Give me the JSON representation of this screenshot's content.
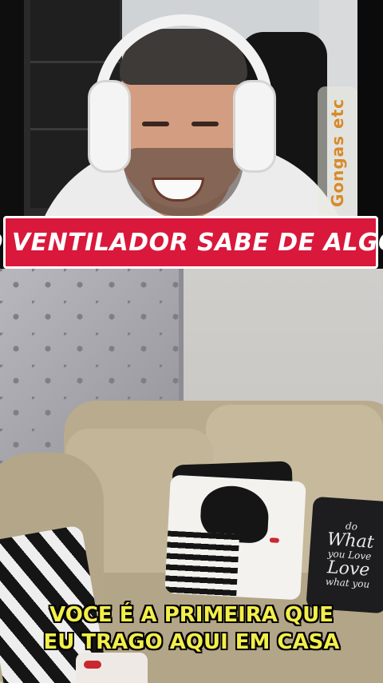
{
  "top_video": {
    "watermark": "Gongas etc"
  },
  "title_banner": {
    "text": "O VENTILADOR SABE DE ALGO",
    "background_color": "#d9183b"
  },
  "bottom_video": {
    "pillow_text": {
      "line1": "do",
      "line2": "What",
      "line3": "you Love",
      "line4": "Love",
      "line5": "what you"
    }
  },
  "subtitle": {
    "line1": "VOCE É A PRIMEIRA QUE",
    "line2": "EU TRAGO AQUI EM CASA",
    "color": "#f3ee4a"
  }
}
